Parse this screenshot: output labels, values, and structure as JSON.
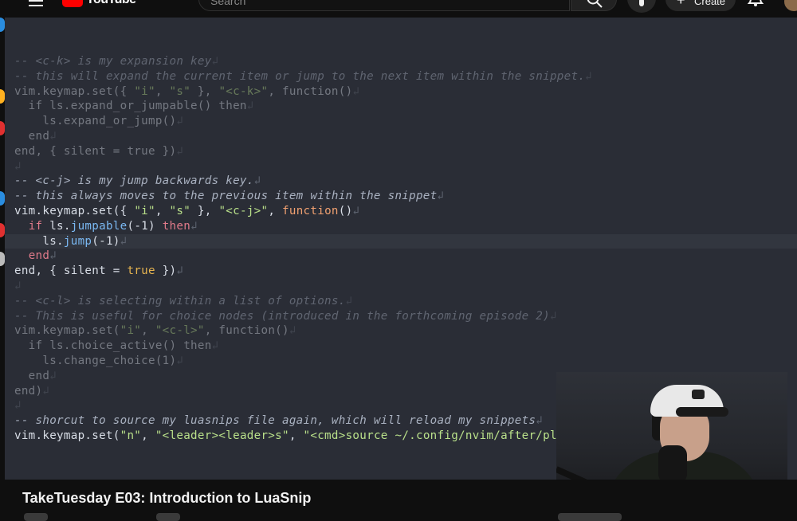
{
  "header": {
    "logo_text": "YouTube",
    "search_placeholder": "Search",
    "create_label": "Create"
  },
  "editor": {
    "lines": [
      {
        "dim": true,
        "current": false,
        "tokens": [
          {
            "t": "-- <c-k> is my expansion key",
            "c": "c"
          },
          {
            "t": "↲",
            "c": "eol"
          }
        ]
      },
      {
        "dim": true,
        "current": false,
        "tokens": [
          {
            "t": "-- this will expand the current item or jump to the next item within the snippet.",
            "c": "c"
          },
          {
            "t": "↲",
            "c": "eol"
          }
        ]
      },
      {
        "dim": true,
        "current": false,
        "tokens": [
          {
            "t": "vim.keymap.set({ ",
            "c": "p"
          },
          {
            "t": "\"i\"",
            "c": "s"
          },
          {
            "t": ", ",
            "c": "p"
          },
          {
            "t": "\"s\"",
            "c": "s"
          },
          {
            "t": " }, ",
            "c": "p"
          },
          {
            "t": "\"<c-k>\"",
            "c": "s"
          },
          {
            "t": ", function()",
            "c": "p"
          },
          {
            "t": "↲",
            "c": "eol"
          }
        ]
      },
      {
        "dim": true,
        "current": false,
        "tokens": [
          {
            "t": "  if ls.expand_or_jumpable() then",
            "c": "p"
          },
          {
            "t": "↲",
            "c": "eol"
          }
        ]
      },
      {
        "dim": true,
        "current": false,
        "tokens": [
          {
            "t": "    ls.expand_or_jump()",
            "c": "p"
          },
          {
            "t": "↲",
            "c": "eol"
          }
        ]
      },
      {
        "dim": true,
        "current": false,
        "tokens": [
          {
            "t": "  end",
            "c": "p"
          },
          {
            "t": "↲",
            "c": "eol"
          }
        ]
      },
      {
        "dim": true,
        "current": false,
        "tokens": [
          {
            "t": "end, { silent = true })",
            "c": "p"
          },
          {
            "t": "↲",
            "c": "eol"
          }
        ]
      },
      {
        "dim": true,
        "current": false,
        "tokens": [
          {
            "t": "↲",
            "c": "eol"
          }
        ]
      },
      {
        "dim": false,
        "current": false,
        "tokens": [
          {
            "t": "-- <c-j> is my jump backwards key.",
            "c": "c"
          },
          {
            "t": "↲",
            "c": "eol"
          }
        ]
      },
      {
        "dim": false,
        "current": false,
        "tokens": [
          {
            "t": "-- this always moves to the previous item within the snippet",
            "c": "c"
          },
          {
            "t": "↲",
            "c": "eol"
          }
        ]
      },
      {
        "dim": false,
        "current": false,
        "tokens": [
          {
            "t": "vim.keymap.set({ ",
            "c": "p"
          },
          {
            "t": "\"i\"",
            "c": "s"
          },
          {
            "t": ", ",
            "c": "p"
          },
          {
            "t": "\"s\"",
            "c": "s"
          },
          {
            "t": " }, ",
            "c": "p"
          },
          {
            "t": "\"<c-j>\"",
            "c": "s"
          },
          {
            "t": ", ",
            "c": "p"
          },
          {
            "t": "function",
            "c": "n"
          },
          {
            "t": "()",
            "c": "p"
          },
          {
            "t": "↲",
            "c": "eol"
          }
        ]
      },
      {
        "dim": false,
        "current": false,
        "tokens": [
          {
            "t": "  ",
            "c": "p"
          },
          {
            "t": "if",
            "c": "k"
          },
          {
            "t": " ls.",
            "c": "p"
          },
          {
            "t": "jumpable",
            "c": "f"
          },
          {
            "t": "(-1) ",
            "c": "p"
          },
          {
            "t": "then",
            "c": "k"
          },
          {
            "t": "↲",
            "c": "eol"
          }
        ]
      },
      {
        "dim": false,
        "current": true,
        "tokens": [
          {
            "t": "    ls.",
            "c": "p"
          },
          {
            "t": "jump",
            "c": "f"
          },
          {
            "t": "(-1)",
            "c": "p"
          },
          {
            "t": "↲",
            "c": "eol"
          }
        ]
      },
      {
        "dim": false,
        "current": false,
        "tokens": [
          {
            "t": "  ",
            "c": "p"
          },
          {
            "t": "end",
            "c": "k"
          },
          {
            "t": "↲",
            "c": "eol"
          }
        ]
      },
      {
        "dim": false,
        "current": false,
        "tokens": [
          {
            "t": "end, { silent = ",
            "c": "p"
          },
          {
            "t": "true",
            "c": "t"
          },
          {
            "t": " })",
            "c": "p"
          },
          {
            "t": "↲",
            "c": "eol"
          }
        ]
      },
      {
        "dim": true,
        "current": false,
        "tokens": [
          {
            "t": "↲",
            "c": "eol"
          }
        ]
      },
      {
        "dim": true,
        "current": false,
        "tokens": [
          {
            "t": "-- <c-l> is selecting within a list of options.",
            "c": "c"
          },
          {
            "t": "↲",
            "c": "eol"
          }
        ]
      },
      {
        "dim": true,
        "current": false,
        "tokens": [
          {
            "t": "-- This is useful for choice nodes (introduced in the forthcoming episode 2)",
            "c": "c"
          },
          {
            "t": "↲",
            "c": "eol"
          }
        ]
      },
      {
        "dim": true,
        "current": false,
        "tokens": [
          {
            "t": "vim.keymap.set(",
            "c": "p"
          },
          {
            "t": "\"i\"",
            "c": "s"
          },
          {
            "t": ", ",
            "c": "p"
          },
          {
            "t": "\"<c-l>\"",
            "c": "s"
          },
          {
            "t": ", function()",
            "c": "p"
          },
          {
            "t": "↲",
            "c": "eol"
          }
        ]
      },
      {
        "dim": true,
        "current": false,
        "tokens": [
          {
            "t": "  if ls.choice_active() then",
            "c": "p"
          },
          {
            "t": "↲",
            "c": "eol"
          }
        ]
      },
      {
        "dim": true,
        "current": false,
        "tokens": [
          {
            "t": "    ls.change_choice(1)",
            "c": "p"
          },
          {
            "t": "↲",
            "c": "eol"
          }
        ]
      },
      {
        "dim": true,
        "current": false,
        "tokens": [
          {
            "t": "  end",
            "c": "p"
          },
          {
            "t": "↲",
            "c": "eol"
          }
        ]
      },
      {
        "dim": true,
        "current": false,
        "tokens": [
          {
            "t": "end)",
            "c": "p"
          },
          {
            "t": "↲",
            "c": "eol"
          }
        ]
      },
      {
        "dim": true,
        "current": false,
        "tokens": [
          {
            "t": "↲",
            "c": "eol"
          }
        ]
      },
      {
        "dim": false,
        "current": false,
        "tokens": [
          {
            "t": "-- shorcut to source my luasnips file again, which will reload my snippets",
            "c": "c"
          },
          {
            "t": "↲",
            "c": "eol"
          }
        ]
      },
      {
        "dim": false,
        "current": false,
        "tokens": [
          {
            "t": "vim.keymap.set(",
            "c": "p"
          },
          {
            "t": "\"n\"",
            "c": "s"
          },
          {
            "t": ", ",
            "c": "p"
          },
          {
            "t": "\"<leader><leader>s\"",
            "c": "s"
          },
          {
            "t": ", ",
            "c": "p"
          },
          {
            "t": "\"<cmd>source ~/.config/nvim/after/plugin/luasnip.lua<CR>\"",
            "c": "s"
          },
          {
            "t": ")",
            "c": "p"
          },
          {
            "t": "↲",
            "c": "eol"
          }
        ]
      }
    ]
  },
  "video": {
    "title": "TakeTuesday E03: Introduction to LuaSnip"
  },
  "colors": {
    "editor_bg": "#2a2d36",
    "string": "#b9e08a",
    "keyword": "#e07a8a",
    "function": "#7ab8f2",
    "boolean": "#e6b450",
    "youtube_red": "#ff0000"
  }
}
